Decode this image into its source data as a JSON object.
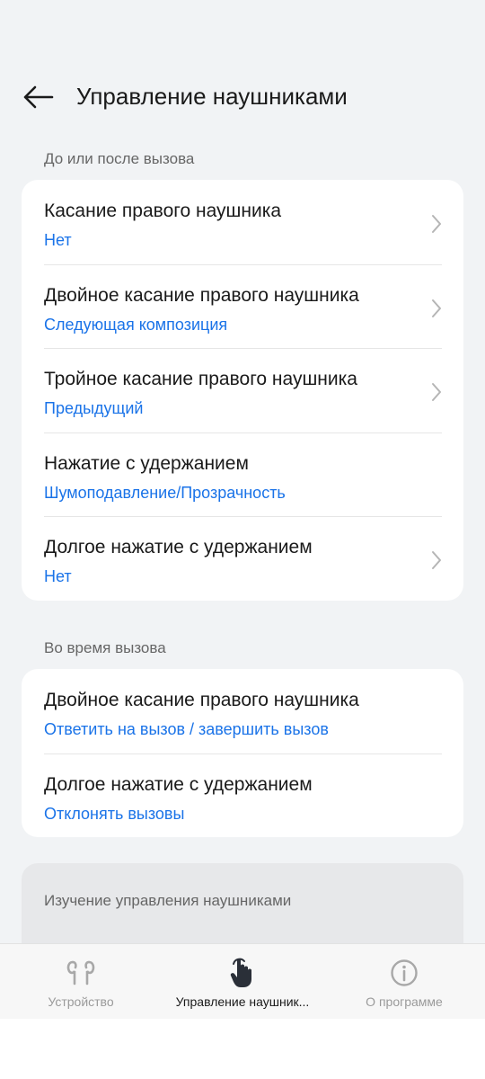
{
  "header": {
    "title": "Управление наушниками"
  },
  "sections": [
    {
      "label": "До или после вызова",
      "rows": [
        {
          "title": "Касание правого наушника",
          "value": "Нет",
          "chevron": true
        },
        {
          "title": "Двойное касание правого наушника",
          "value": "Следующая композиция",
          "chevron": true
        },
        {
          "title": "Тройное касание правого наушника",
          "value": "Предыдущий",
          "chevron": true
        },
        {
          "title": "Нажатие с удержанием",
          "value": "Шумоподавление/Прозрачность",
          "chevron": false
        },
        {
          "title": "Долгое нажатие с удержанием",
          "value": "Нет",
          "chevron": true
        }
      ]
    },
    {
      "label": "Во время вызова",
      "rows": [
        {
          "title": "Двойное касание правого наушника",
          "value": "Ответить на вызов / завершить вызов",
          "chevron": false
        },
        {
          "title": "Долгое нажатие с удержанием",
          "value": "Отклонять вызовы",
          "chevron": false
        }
      ]
    }
  ],
  "learn": {
    "label": "Изучение управления наушниками"
  },
  "bottom_nav": {
    "items": [
      {
        "label": "Устройство",
        "icon": "earbuds-icon",
        "active": false
      },
      {
        "label": "Управление наушник...",
        "icon": "touch-gesture-icon",
        "active": true
      },
      {
        "label": "О программе",
        "icon": "info-icon",
        "active": false
      }
    ]
  },
  "colors": {
    "accent": "#1a73e8",
    "background": "#f1f3f5",
    "card": "#ffffff",
    "active_nav": "#1a1a1a",
    "inactive_nav": "#9a9a9a"
  }
}
